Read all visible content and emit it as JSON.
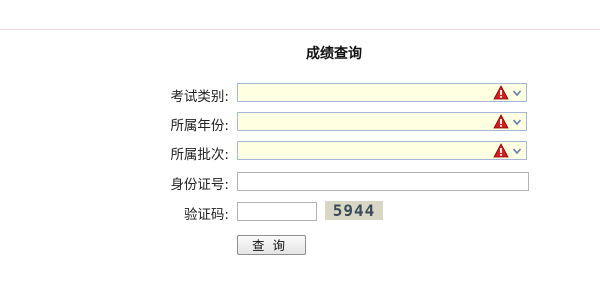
{
  "title": "成绩查询",
  "form": {
    "exam_type": {
      "label": "考试类别:",
      "value": "",
      "warning_icon": "warning-icon",
      "dropdown_icon": "chevron-down-icon"
    },
    "year": {
      "label": "所属年份:",
      "value": "",
      "warning_icon": "warning-icon",
      "dropdown_icon": "chevron-down-icon"
    },
    "batch": {
      "label": "所属批次:",
      "value": "",
      "warning_icon": "warning-icon",
      "dropdown_icon": "chevron-down-icon"
    },
    "id_number": {
      "label": "身份证号:",
      "value": ""
    },
    "captcha": {
      "label": "验证码:",
      "value": "",
      "image_text": "5944"
    },
    "submit_label": "查询"
  },
  "colors": {
    "select_bg": "#ffffe1",
    "select_border": "#a5b8d6",
    "warning_red": "#cc0000",
    "captcha_bg": "#d8d6c4"
  }
}
